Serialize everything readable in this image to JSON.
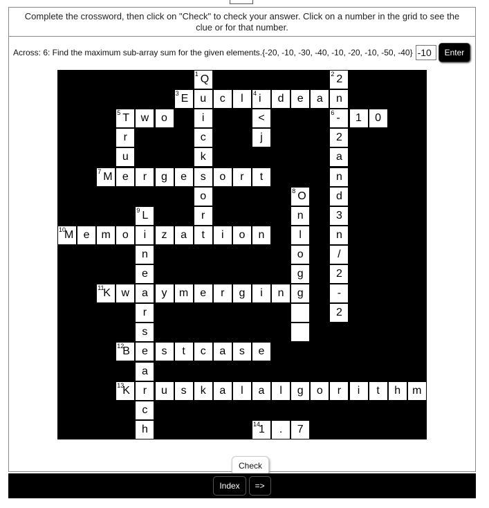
{
  "instructions": "Complete the crossword, then click on \"Check\" to check your answer. Click on a number in the grid to see the clue or for that number.",
  "clue": {
    "text": "Across: 6: Find the maximum sub-array sum for the given elements.{-20, -10, -30, -40, -10, -20, -10, -50, -40}",
    "answer_value": "-10",
    "enter_label": "Enter"
  },
  "grid": {
    "cells": [
      {
        "r": 0,
        "c": 7,
        "n": "1",
        "t": "Q"
      },
      {
        "r": 0,
        "c": 14,
        "n": "2",
        "t": "2"
      },
      {
        "r": 1,
        "c": 6,
        "n": "3",
        "t": "E"
      },
      {
        "r": 1,
        "c": 7,
        "t": "u"
      },
      {
        "r": 1,
        "c": 8,
        "t": "c"
      },
      {
        "r": 1,
        "c": 9,
        "t": "l"
      },
      {
        "r": 1,
        "c": 10,
        "n": "4",
        "t": "i"
      },
      {
        "r": 1,
        "c": 11,
        "t": "d"
      },
      {
        "r": 1,
        "c": 12,
        "t": "e"
      },
      {
        "r": 1,
        "c": 13,
        "t": "a"
      },
      {
        "r": 1,
        "c": 14,
        "t": "n"
      },
      {
        "r": 2,
        "c": 3,
        "n": "5",
        "t": "T"
      },
      {
        "r": 2,
        "c": 4,
        "t": "w"
      },
      {
        "r": 2,
        "c": 5,
        "t": "o"
      },
      {
        "r": 2,
        "c": 7,
        "t": "i"
      },
      {
        "r": 2,
        "c": 10,
        "t": "<"
      },
      {
        "r": 2,
        "c": 14,
        "n": "6",
        "t": "-"
      },
      {
        "r": 2,
        "c": 15,
        "t": "1"
      },
      {
        "r": 2,
        "c": 16,
        "t": "0"
      },
      {
        "r": 3,
        "c": 3,
        "t": "r"
      },
      {
        "r": 3,
        "c": 7,
        "t": "c"
      },
      {
        "r": 3,
        "c": 10,
        "t": "j"
      },
      {
        "r": 3,
        "c": 14,
        "t": "2"
      },
      {
        "r": 4,
        "c": 3,
        "t": "u"
      },
      {
        "r": 4,
        "c": 7,
        "t": "k"
      },
      {
        "r": 4,
        "c": 14,
        "t": "a"
      },
      {
        "r": 5,
        "c": 2,
        "n": "7",
        "t": "M"
      },
      {
        "r": 5,
        "c": 3,
        "t": "e"
      },
      {
        "r": 5,
        "c": 4,
        "t": "r"
      },
      {
        "r": 5,
        "c": 5,
        "t": "g"
      },
      {
        "r": 5,
        "c": 6,
        "t": "e"
      },
      {
        "r": 5,
        "c": 7,
        "t": "s"
      },
      {
        "r": 5,
        "c": 8,
        "t": "o"
      },
      {
        "r": 5,
        "c": 9,
        "t": "r"
      },
      {
        "r": 5,
        "c": 10,
        "t": "t"
      },
      {
        "r": 5,
        "c": 14,
        "t": "n"
      },
      {
        "r": 6,
        "c": 7,
        "t": "o"
      },
      {
        "r": 6,
        "c": 12,
        "n": "8",
        "t": "O"
      },
      {
        "r": 6,
        "c": 14,
        "t": "d"
      },
      {
        "r": 7,
        "c": 4,
        "n": "9",
        "t": "L"
      },
      {
        "r": 7,
        "c": 7,
        "t": "r"
      },
      {
        "r": 7,
        "c": 12,
        "t": "n"
      },
      {
        "r": 7,
        "c": 14,
        "t": "3"
      },
      {
        "r": 8,
        "c": 0,
        "n": "10",
        "t": "M"
      },
      {
        "r": 8,
        "c": 1,
        "t": "e"
      },
      {
        "r": 8,
        "c": 2,
        "t": "m"
      },
      {
        "r": 8,
        "c": 3,
        "t": "o"
      },
      {
        "r": 8,
        "c": 4,
        "t": "i"
      },
      {
        "r": 8,
        "c": 5,
        "t": "z"
      },
      {
        "r": 8,
        "c": 6,
        "t": "a"
      },
      {
        "r": 8,
        "c": 7,
        "t": "t"
      },
      {
        "r": 8,
        "c": 8,
        "t": "i"
      },
      {
        "r": 8,
        "c": 9,
        "t": "o"
      },
      {
        "r": 8,
        "c": 10,
        "t": "n"
      },
      {
        "r": 8,
        "c": 12,
        "t": "l"
      },
      {
        "r": 8,
        "c": 14,
        "t": "n"
      },
      {
        "r": 9,
        "c": 4,
        "t": "n"
      },
      {
        "r": 9,
        "c": 12,
        "t": "o"
      },
      {
        "r": 9,
        "c": 14,
        "t": "/"
      },
      {
        "r": 10,
        "c": 4,
        "t": "e"
      },
      {
        "r": 10,
        "c": 12,
        "t": "g"
      },
      {
        "r": 10,
        "c": 14,
        "t": "2"
      },
      {
        "r": 11,
        "c": 2,
        "n": "11",
        "t": "K"
      },
      {
        "r": 11,
        "c": 3,
        "t": "w"
      },
      {
        "r": 11,
        "c": 4,
        "t": "a"
      },
      {
        "r": 11,
        "c": 5,
        "t": "y"
      },
      {
        "r": 11,
        "c": 6,
        "t": "m"
      },
      {
        "r": 11,
        "c": 7,
        "t": "e"
      },
      {
        "r": 11,
        "c": 8,
        "t": "r"
      },
      {
        "r": 11,
        "c": 9,
        "t": "g"
      },
      {
        "r": 11,
        "c": 10,
        "t": "i"
      },
      {
        "r": 11,
        "c": 11,
        "t": "n"
      },
      {
        "r": 11,
        "c": 12,
        "t": "g"
      },
      {
        "r": 11,
        "c": 14,
        "t": "-"
      },
      {
        "r": 12,
        "c": 4,
        "t": "r"
      },
      {
        "r": 12,
        "c": 12,
        "t": ""
      },
      {
        "r": 12,
        "c": 14,
        "t": "2"
      },
      {
        "r": 13,
        "c": 4,
        "t": "s"
      },
      {
        "r": 13,
        "c": 12,
        "t": ""
      },
      {
        "r": 14,
        "c": 3,
        "n": "12",
        "t": "B"
      },
      {
        "r": 14,
        "c": 4,
        "t": "e"
      },
      {
        "r": 14,
        "c": 5,
        "t": "s"
      },
      {
        "r": 14,
        "c": 6,
        "t": "t"
      },
      {
        "r": 14,
        "c": 7,
        "t": "c"
      },
      {
        "r": 14,
        "c": 8,
        "t": "a"
      },
      {
        "r": 14,
        "c": 9,
        "t": "s"
      },
      {
        "r": 14,
        "c": 10,
        "t": "e"
      },
      {
        "r": 15,
        "c": 4,
        "t": "a"
      },
      {
        "r": 16,
        "c": 3,
        "n": "13",
        "t": "K"
      },
      {
        "r": 16,
        "c": 4,
        "t": "r"
      },
      {
        "r": 16,
        "c": 5,
        "t": "u"
      },
      {
        "r": 16,
        "c": 6,
        "t": "s"
      },
      {
        "r": 16,
        "c": 7,
        "t": "k"
      },
      {
        "r": 16,
        "c": 8,
        "t": "a"
      },
      {
        "r": 16,
        "c": 9,
        "t": "l"
      },
      {
        "r": 16,
        "c": 10,
        "t": "a"
      },
      {
        "r": 16,
        "c": 11,
        "t": "l"
      },
      {
        "r": 16,
        "c": 12,
        "t": "g"
      },
      {
        "r": 16,
        "c": 13,
        "t": "o"
      },
      {
        "r": 16,
        "c": 14,
        "t": "r"
      },
      {
        "r": 16,
        "c": 15,
        "t": "i"
      },
      {
        "r": 16,
        "c": 16,
        "t": "t"
      },
      {
        "r": 16,
        "c": 17,
        "t": "h"
      },
      {
        "r": 16,
        "c": 18,
        "t": "m"
      },
      {
        "r": 17,
        "c": 4,
        "t": "c"
      },
      {
        "r": 18,
        "c": 4,
        "t": "h"
      },
      {
        "r": 18,
        "c": 10,
        "n": "14",
        "t": "1"
      },
      {
        "r": 18,
        "c": 11,
        "t": "."
      },
      {
        "r": 18,
        "c": 12,
        "t": "7"
      }
    ]
  },
  "check_label": "Check",
  "footer": {
    "index_label": "Index",
    "next_label": "=>"
  }
}
